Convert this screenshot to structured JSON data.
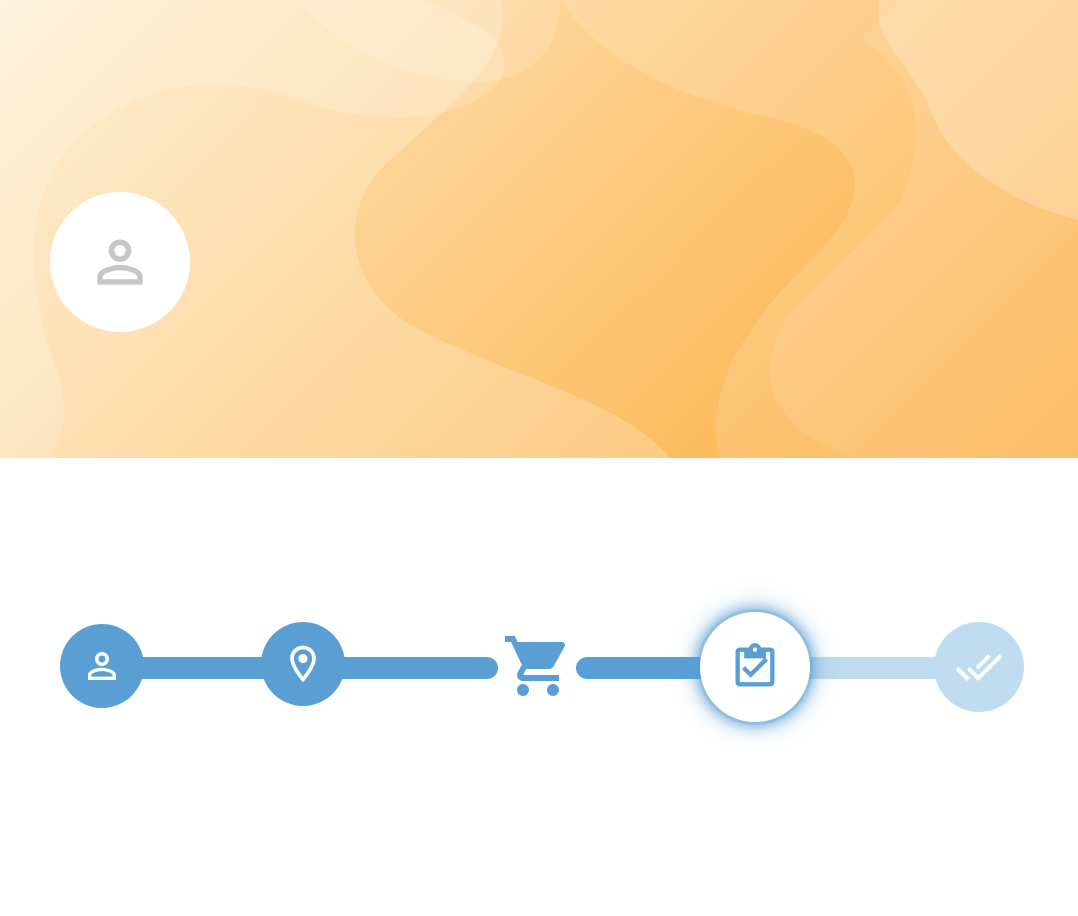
{
  "header": {
    "avatar_icon": "person-outline-icon",
    "banner_colors": [
      "#fdebc8",
      "#fdd597",
      "#fdbf66",
      "#fdaa3c"
    ]
  },
  "stepper": {
    "accent_color": "#5a9fd4",
    "inactive_color": "#bfdcf0",
    "current_step": 4,
    "steps": [
      {
        "icon": "person-icon",
        "state": "completed"
      },
      {
        "icon": "location-pin-icon",
        "state": "completed"
      },
      {
        "icon": "shopping-cart-icon",
        "state": "completed"
      },
      {
        "icon": "clipboard-check-icon",
        "state": "current"
      },
      {
        "icon": "double-check-icon",
        "state": "pending"
      }
    ]
  }
}
